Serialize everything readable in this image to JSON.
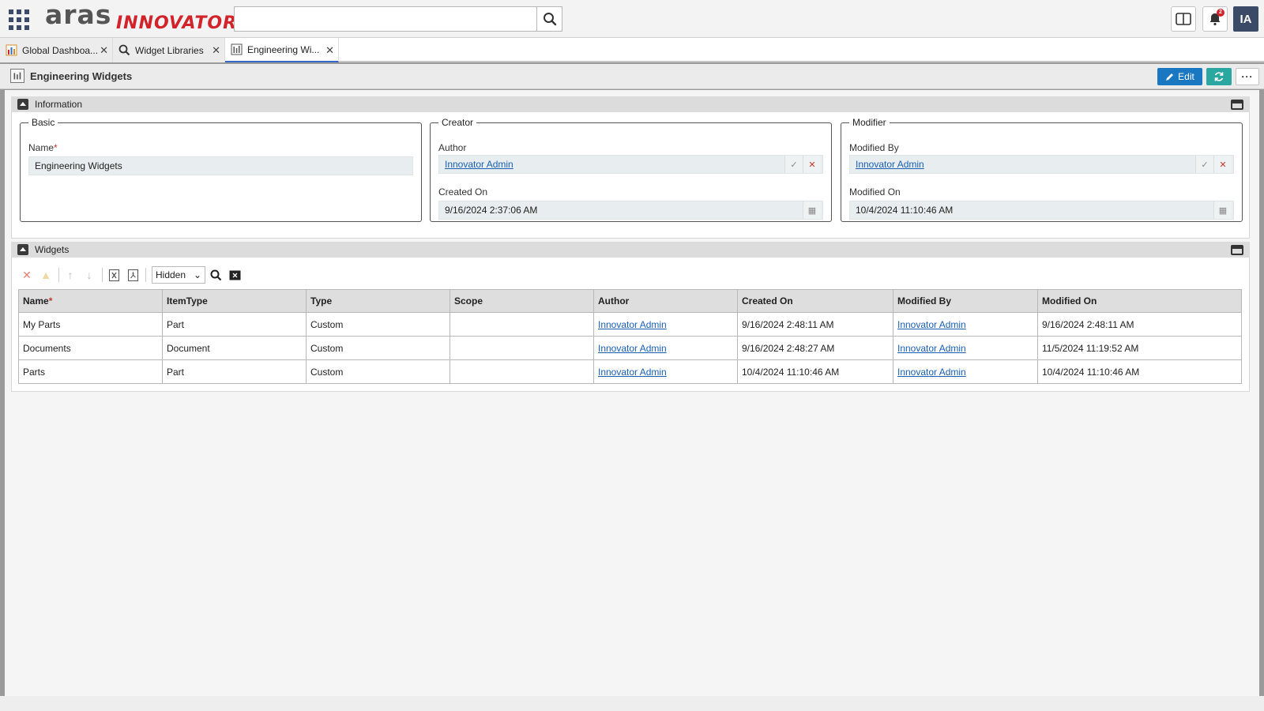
{
  "header": {
    "logo_text_1": "aras",
    "logo_text_2": "INNOVATOR",
    "search_placeholder": "",
    "notification_count": "2",
    "user_initials": "IA"
  },
  "tabs": [
    {
      "label": "Global Dashboa...",
      "icon": "dashboard-icon"
    },
    {
      "label": "Widget Libraries",
      "icon": "search-icon"
    },
    {
      "label": "Engineering Wi...",
      "icon": "widget-icon"
    }
  ],
  "item": {
    "title": "Engineering Widgets",
    "edit_label": "Edit",
    "more_label": "···"
  },
  "information": {
    "title": "Information",
    "basic": {
      "legend": "Basic",
      "name_label": "Name",
      "required_mark": "*",
      "name_value": "Engineering Widgets"
    },
    "creator": {
      "legend": "Creator",
      "author_label": "Author",
      "author_value": "Innovator Admin",
      "created_label": "Created On",
      "created_value": "9/16/2024 2:37:06 AM"
    },
    "modifier": {
      "legend": "Modifier",
      "modified_by_label": "Modified By",
      "modified_by_value": "Innovator Admin",
      "modified_on_label": "Modified On",
      "modified_on_value": "10/4/2024 11:10:46 AM"
    }
  },
  "widgets": {
    "title": "Widgets",
    "filter_value": "Hidden",
    "columns": [
      "Name",
      "ItemType",
      "Type",
      "Scope",
      "Author",
      "Created On",
      "Modified By",
      "Modified On"
    ],
    "rows": [
      {
        "name": "My Parts",
        "itemtype": "Part",
        "type": "Custom",
        "scope": "",
        "author": "Innovator Admin",
        "created_on": "9/16/2024 2:48:11 AM",
        "modified_by": "Innovator Admin",
        "modified_on": "9/16/2024 2:48:11 AM"
      },
      {
        "name": "Documents",
        "itemtype": "Document",
        "type": "Custom",
        "scope": "",
        "author": "Innovator Admin",
        "created_on": "9/16/2024 2:48:27 AM",
        "modified_by": "Innovator Admin",
        "modified_on": "11/5/2024 11:19:52 AM"
      },
      {
        "name": "Parts",
        "itemtype": "Part",
        "type": "Custom",
        "scope": "",
        "author": "Innovator Admin",
        "created_on": "10/4/2024 11:10:46 AM",
        "modified_by": "Innovator Admin",
        "modified_on": "10/4/2024 11:10:46 AM"
      }
    ]
  },
  "colors": {
    "brand_red": "#d2232a",
    "primary_blue": "#1a78c2",
    "teal": "#2aa7a0",
    "link": "#1a5fb4",
    "avatar_bg": "#3b4a66"
  }
}
